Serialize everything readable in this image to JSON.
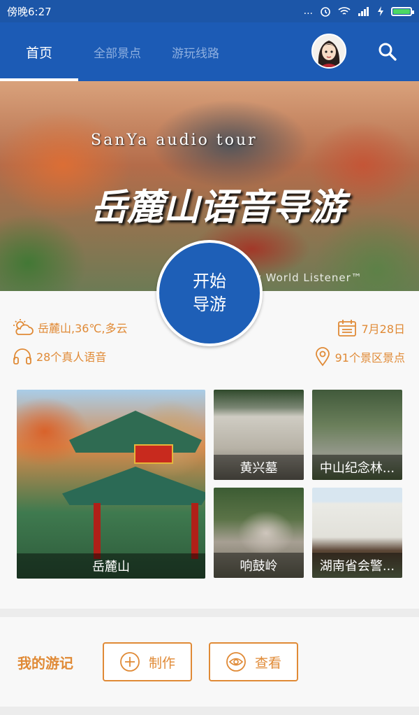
{
  "status_bar": {
    "time": "傍晚6:27",
    "signal": "..."
  },
  "nav": {
    "tabs": [
      {
        "label": "首页",
        "active": true
      },
      {
        "label": "全部景点",
        "active": false
      },
      {
        "label": "游玩线路",
        "active": false
      }
    ],
    "avatar_icon": "avatar-icon",
    "search_icon": "search-icon"
  },
  "banner": {
    "subtitle": "SanYa audio tour",
    "title": "岳麓山语音导游",
    "credit": "y World Listener™"
  },
  "start_button": {
    "line1": "开始",
    "line2": "导游"
  },
  "info": {
    "weather": "岳麓山,36℃,多云",
    "date": "7月28日",
    "voices": "28个真人语音",
    "spots": "91个景区景点"
  },
  "spots": [
    {
      "label": "岳麓山"
    },
    {
      "label": "黄兴墓"
    },
    {
      "label": "中山纪念林..."
    },
    {
      "label": "响鼓岭"
    },
    {
      "label": "湖南省会警..."
    }
  ],
  "journal": {
    "title": "我的游记",
    "make_label": "制作",
    "view_label": "查看"
  },
  "colors": {
    "brand_blue": "#1c5bb5",
    "accent_orange": "#e08a36"
  }
}
